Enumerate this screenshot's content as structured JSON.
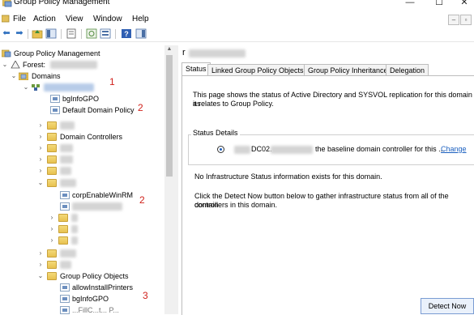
{
  "window": {
    "title": "Group Policy Management",
    "controls": [
      "—",
      "☐",
      "✕"
    ]
  },
  "menu": {
    "items": [
      "File",
      "Action",
      "View",
      "Window",
      "Help"
    ],
    "mdi_controls": [
      "–",
      "▫"
    ]
  },
  "toolbar": {
    "icons": [
      "back-arrow-icon",
      "forward-arrow-icon",
      "folder-up-icon",
      "show-hide-tree-icon",
      "properties-icon",
      "refresh-icon",
      "export-list-icon",
      "help-icon",
      "console-icon"
    ]
  },
  "tree": {
    "root_label": "Group Policy Management",
    "forest_label": "Forest:",
    "domains_label": "Domains",
    "bginfo_label": "bgInfoGPO",
    "default_domain_policy_label": "Default Domain Policy",
    "domain_controllers_label": "Domain Controllers",
    "corp_winrm_label": "corpEnableWinRM",
    "gpo_container_label": "Group Policy Objects",
    "allow_install_label": "allowInstallPrinters",
    "bginfo2_label": "bgInfoGPO",
    "partial_label": "...FillC...t... P...",
    "marks": [
      "1",
      "2",
      "2",
      "3"
    ]
  },
  "details": {
    "domain_name_visible": "r",
    "tabs": [
      "Status",
      "Linked Group Policy Objects",
      "Group Policy Inheritance",
      "Delegation"
    ],
    "active_tab": "Status",
    "intro_line1": "This page shows the status of Active Directory and SYSVOL replication for this domain as",
    "intro_line2": "it relates to Group Policy.",
    "status_details_label": "Status Details",
    "dc_prefix": "DC02.",
    "dc_suffix": "the baseline domain controller for this ...",
    "change_link": "Change",
    "no_info_text": "No Infrastructure Status information exists for this domain.",
    "detect_line1": "Click the Detect Now button below to gather infrastructure status from all of the domain",
    "detect_line2": "controllers in this domain.",
    "detect_button": "Detect Now"
  },
  "colors": {
    "accent_link": "#1a5fbf",
    "annotation_red": "#d0211b",
    "folder_yellow": "#e8c150"
  }
}
